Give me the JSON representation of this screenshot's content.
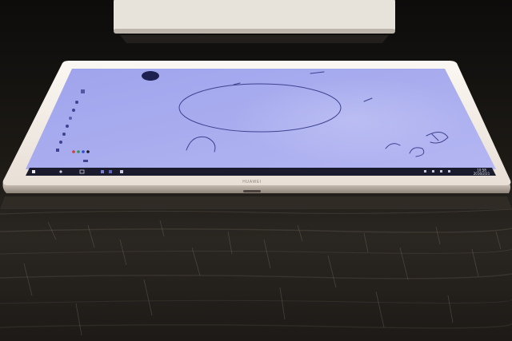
{
  "scene": {
    "subject": "tablet-on-table",
    "brand_label": "HUAWEI",
    "os": "Windows 10",
    "app": "drawing canvas with pen toolbar",
    "taskbar_clock": [
      "10:58",
      "2016/2/21"
    ],
    "colors": {
      "table": "#1c1915",
      "table_highlight": "#6b625a",
      "bezel": "#f2ece6",
      "screen": "#a6a9ee",
      "taskbar": "#1a1c2e",
      "ink": "#3f4290"
    }
  }
}
